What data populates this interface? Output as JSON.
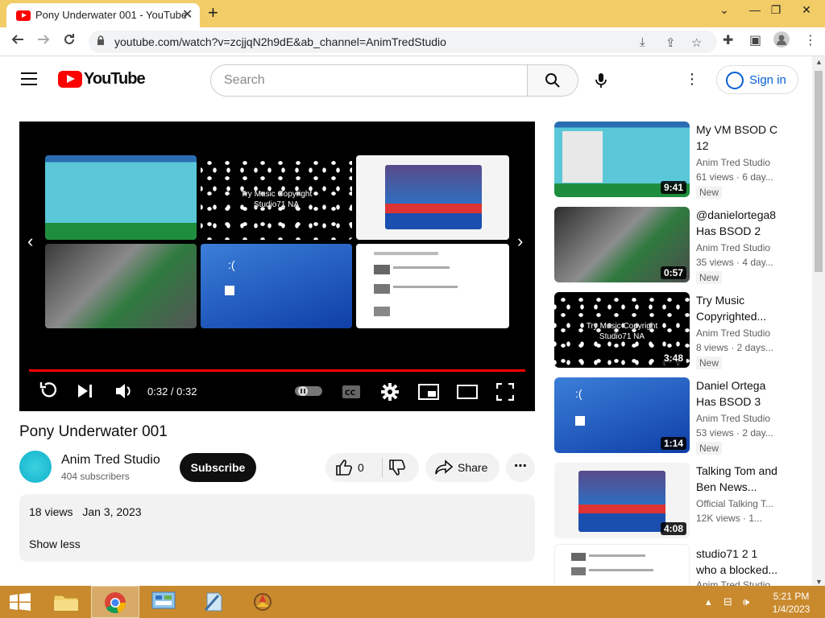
{
  "browser": {
    "tab_title": "Pony Underwater 001 - YouTube",
    "tab_close": "✕",
    "new_tab": "+",
    "url": "youtube.com/watch?v=zcjjqN2h9dE&ab_channel=AnimTredStudio",
    "window_controls": {
      "dropdown": "⌄",
      "minimize": "—",
      "restore": "❐",
      "close": "✕"
    }
  },
  "header": {
    "logo_text": "YouTube",
    "search_placeholder": "Search",
    "sign_in": "Sign in"
  },
  "player": {
    "overlay_text_line1": "Try Music Copyright",
    "overlay_text_line2": "Studio71 NA",
    "time": "0:32 / 0:32",
    "progress": 1.0
  },
  "video": {
    "title": "Pony Underwater 001",
    "channel": "Anim Tred Studio",
    "subscribers": "404 subscribers",
    "subscribe_label": "Subscribe",
    "likes": "0",
    "share_label": "Share",
    "more_label": "⋯",
    "views": "18 views",
    "date": "Jan 3, 2023",
    "show_less": "Show less"
  },
  "recommendations": [
    {
      "title": "My VM BSOD C 12",
      "channel": "Anim Tred Studio",
      "views": "61 views · 6 day...",
      "badge": "New",
      "duration": "9:41"
    },
    {
      "title": "@danielortega8 Has BSOD 2",
      "channel": "Anim Tred Studio",
      "views": "35 views · 4 day...",
      "badge": "New",
      "duration": "0:57"
    },
    {
      "title": "Try Music Copyrighted...",
      "channel": "Anim Tred Studio",
      "views": "8 views · 2 days...",
      "badge": "New",
      "duration": "3:48",
      "overlay1": "Try Music Copyright",
      "overlay2": "Studio71 NA"
    },
    {
      "title": "Daniel Ortega Has BSOD 3",
      "channel": "Anim Tred Studio",
      "views": "53 views · 2 day...",
      "badge": "New",
      "duration": "1:14"
    },
    {
      "title": "Talking Tom and Ben News...",
      "channel": "Official Talking T...",
      "views": "12K views · 1...",
      "duration": "4:08"
    },
    {
      "title": "studio71 2 1 who a blocked...",
      "channel": "Anim Tred Studio",
      "views": ""
    }
  ],
  "taskbar": {
    "time": "5:21 PM",
    "date": "1/4/2023"
  },
  "colors": {
    "accent_red": "#ff0000",
    "link_blue": "#065fd4",
    "taskbar": "#c98a2e",
    "tabstrip": "#f2cc66"
  }
}
